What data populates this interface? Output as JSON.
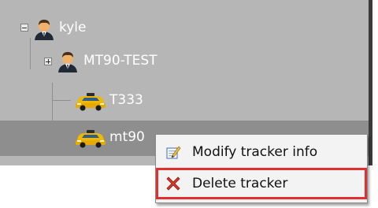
{
  "tree": {
    "nodes": [
      {
        "label": "kyle",
        "icon": "user-icon",
        "expander": "collapse-icon"
      },
      {
        "label": "MT90-TEST",
        "icon": "user-icon",
        "expander": "expand-icon"
      },
      {
        "label": "T333",
        "icon": "car-icon"
      },
      {
        "label": "mt90",
        "icon": "car-icon",
        "selected": true
      }
    ]
  },
  "context_menu": {
    "items": [
      {
        "label": "Modify tracker info",
        "icon": "edit-icon"
      },
      {
        "label": "Delete tracker",
        "icon": "delete-icon",
        "highlighted": true
      }
    ]
  },
  "colors": {
    "panel_bg": "#b6b6b6",
    "selected_row": "#8e8e8e",
    "highlight_border": "#e03030"
  }
}
